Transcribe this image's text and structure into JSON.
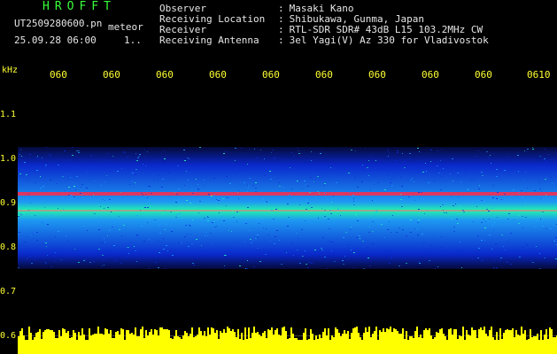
{
  "header": {
    "program": "HROFFT",
    "filename": "UT2509280600.pn",
    "meteor_label": "meteor",
    "datetime": "25.09.28 06:00",
    "page_indicator": "1.."
  },
  "station": {
    "rows": [
      {
        "key": "Observer",
        "sep": ":",
        "value": "Masaki Kano"
      },
      {
        "key": "Receiving Location",
        "sep": ":",
        "value": "Shibukawa, Gunma, Japan"
      },
      {
        "key": "Receiver",
        "sep": ":",
        "value": "RTL-SDR SDR# 43dB L15 103.2MHz CW"
      },
      {
        "key": "Receiving Antenna",
        "sep": ":",
        "value": "3el Yagi(V) Az 330 for Vladivostok"
      }
    ]
  },
  "axes": {
    "unit": "kHz",
    "x_ticks": [
      "060",
      "060",
      "060",
      "060",
      "060",
      "060",
      "060",
      "060",
      "060",
      "0610"
    ],
    "y_ticks": [
      "1.1",
      "1.0",
      "0.9",
      "0.8",
      "0.7",
      "0.6"
    ]
  },
  "colors": {
    "tick_text": "#ffff33",
    "brand": "#39ff39",
    "noise_low": "#0b2bd6",
    "noise_mid": "#1fa0ff",
    "noise_high": "#24ffb5",
    "signal": "#ff2a4a",
    "audio": "#ffff00"
  }
}
